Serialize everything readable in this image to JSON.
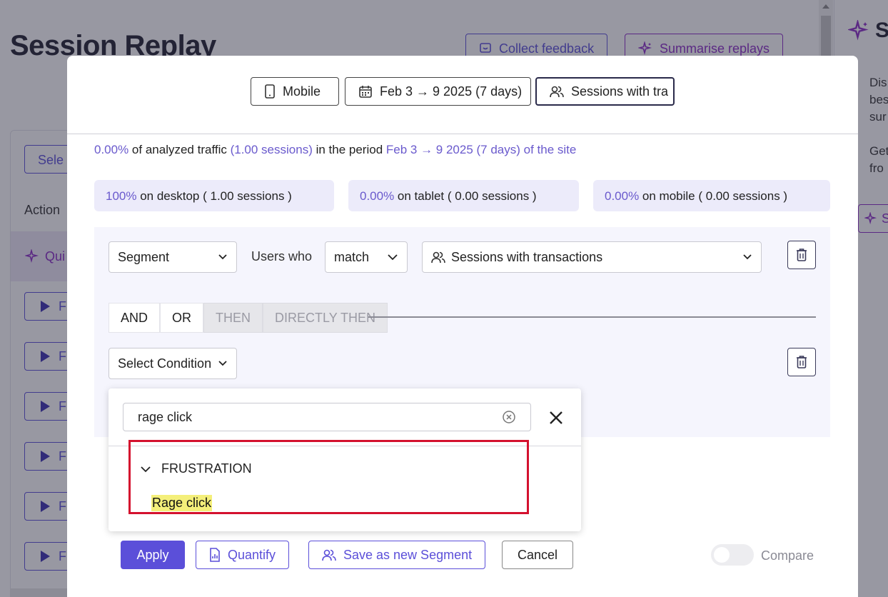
{
  "background": {
    "title": "Session Replay",
    "collect_feedback": "Collect feedback",
    "summarise_replays": "Summarise replays",
    "select_btn": "Sele",
    "action_header": "Action",
    "quick_label": "Qui",
    "play_rows": [
      "F",
      "F",
      "F",
      "F",
      "F",
      "F"
    ],
    "side_title": "S",
    "side_lines_1": [
      "Dis",
      "bes",
      "sur"
    ],
    "side_lines_2": [
      "Get",
      "fro"
    ],
    "side_btn": "S"
  },
  "filters": {
    "device": "Mobile",
    "date": "Feb 3 → 9 2025 (7 days)",
    "segment": "Sessions with tra"
  },
  "traffic": {
    "percent": "0.00%",
    "text1": " of analyzed traffic ",
    "sessions": "(1.00 sessions)",
    "text2": " in the period ",
    "period": "Feb 3 → 9 2025 (7 days) of the site"
  },
  "stats": [
    {
      "pct": "100%",
      "label": " on desktop ( 1.00 sessions )"
    },
    {
      "pct": "0.00%",
      "label": " on tablet ( 0.00 sessions )"
    },
    {
      "pct": "0.00%",
      "label": " on mobile ( 0.00 sessions )"
    }
  ],
  "segment_row": {
    "type": "Segment",
    "users_who": "Users who",
    "match": "match",
    "segment_name": "Sessions with transactions"
  },
  "logic": {
    "and": "AND",
    "or": "OR",
    "then": "THEN",
    "directly_then": "DIRECTLY THEN"
  },
  "condition": {
    "select_label": "Select Condition",
    "search_value": "rage click",
    "group": "FRUSTRATION",
    "result": "Rage click"
  },
  "footer": {
    "apply": "Apply",
    "quantify": "Quantify",
    "save_segment": "Save as new Segment",
    "cancel": "Cancel",
    "compare": "Compare"
  },
  "colors": {
    "accent": "#5b4fd9",
    "ai_purple": "#8a2bc5",
    "highlight": "#f4ef7a",
    "annotation_red": "#d4112e"
  }
}
